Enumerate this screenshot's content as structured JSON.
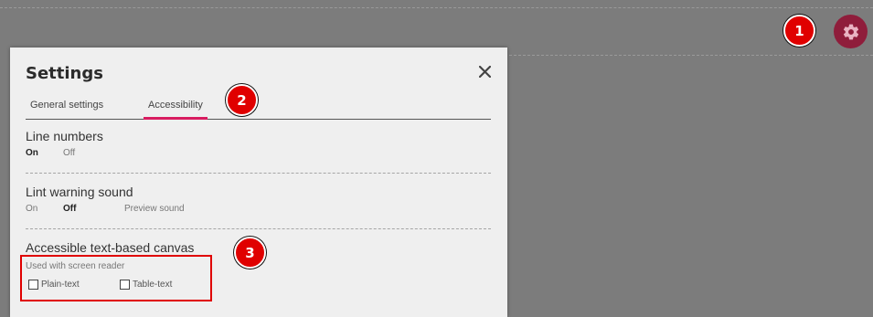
{
  "markers": [
    "1",
    "2",
    "3"
  ],
  "settings_button": {
    "icon": "gear-icon",
    "color": "#8f1d3b"
  },
  "panel": {
    "title": "Settings",
    "close_label": "✕",
    "tabs": [
      {
        "label": "General settings",
        "active": false
      },
      {
        "label": "Accessibility",
        "active": true
      }
    ],
    "accent_color": "#d81b60",
    "sections": {
      "line_numbers": {
        "title": "Line numbers",
        "on": "On",
        "off": "Off",
        "selected": "On"
      },
      "lint_warning": {
        "title": "Lint warning sound",
        "on": "On",
        "off": "Off",
        "preview": "Preview sound",
        "selected": "Off"
      },
      "canvas": {
        "title": "Accessible text-based canvas",
        "subtitle": "Used with screen reader",
        "plain": "Plain-text",
        "table": "Table-text"
      }
    }
  }
}
